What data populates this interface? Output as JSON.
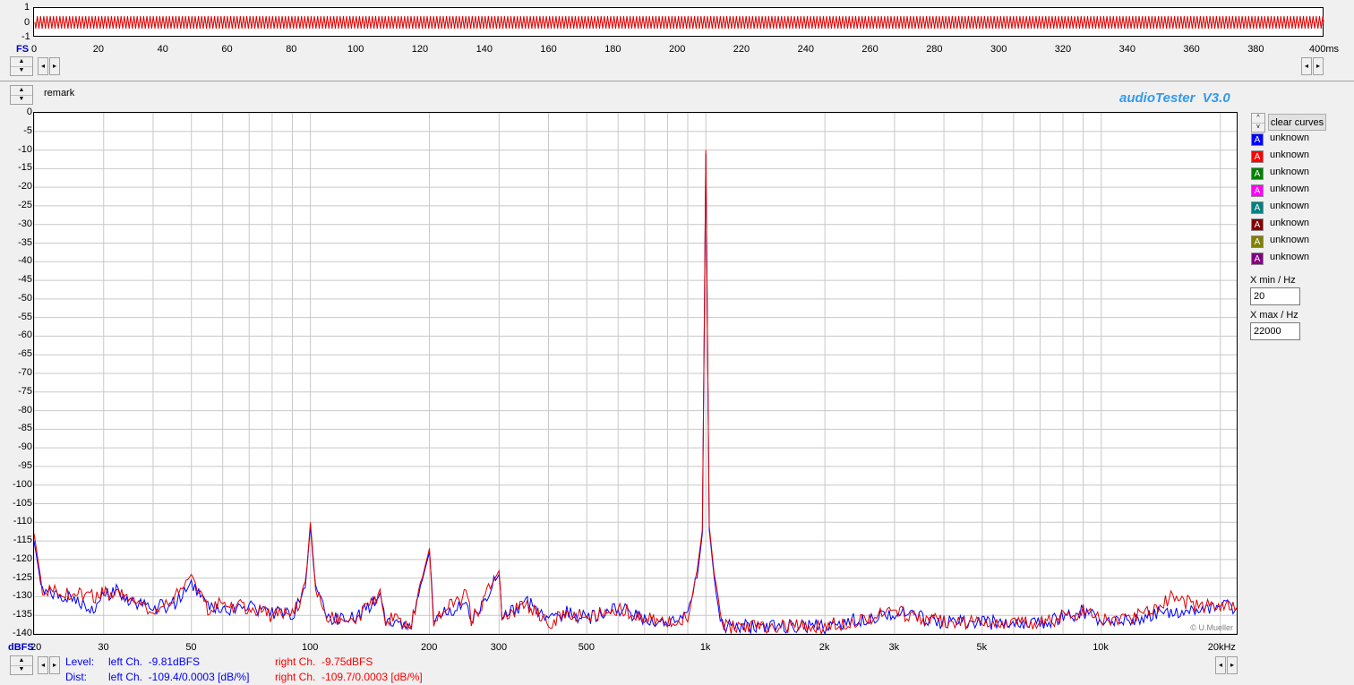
{
  "scope": {
    "y_ticks": [
      "1",
      "0",
      "-1"
    ],
    "x_unit_label": "FS",
    "x_ticks": [
      "0",
      "20",
      "40",
      "60",
      "80",
      "100",
      "120",
      "140",
      "160",
      "180",
      "200",
      "220",
      "240",
      "260",
      "280",
      "300",
      "320",
      "340",
      "360",
      "380",
      "400ms"
    ],
    "trace_color": "#e00000"
  },
  "remark_label": "remark",
  "brand": "audioTester  V3.0",
  "copyright": "© U.Mueller",
  "clear_curves_label": "clear curves",
  "legend": [
    {
      "label": "unknown",
      "letter": "A",
      "color": "#0000ff"
    },
    {
      "label": "unknown",
      "letter": "A",
      "color": "#ff0000"
    },
    {
      "label": "unknown",
      "letter": "A",
      "color": "#008000"
    },
    {
      "label": "unknown",
      "letter": "A",
      "color": "#ff00ff"
    },
    {
      "label": "unknown",
      "letter": "A",
      "color": "#008080"
    },
    {
      "label": "unknown",
      "letter": "A",
      "color": "#800000"
    },
    {
      "label": "unknown",
      "letter": "A",
      "color": "#808000"
    },
    {
      "label": "unknown",
      "letter": "A",
      "color": "#800080"
    }
  ],
  "xmin": {
    "label": "X min / Hz",
    "value": "20"
  },
  "xmax": {
    "label": "X max / Hz",
    "value": "22000"
  },
  "readout": {
    "level_label": "Level:",
    "dist_label": "Dist:",
    "left_level": "left Ch.  -9.81dBFS",
    "right_level": "right Ch.  -9.75dBFS",
    "left_dist": "left Ch.  -109.4/0.0003 [dB/%]",
    "right_dist": "right Ch.  -109.7/0.0003 [dB/%]",
    "left_color": "#0000ff",
    "right_color": "#ff0000"
  },
  "chart_data": {
    "type": "line",
    "title": "",
    "xlabel": "",
    "ylabel": "dBFS",
    "x_scale": "log",
    "xlim": [
      20,
      22000
    ],
    "ylim": [
      -140,
      0
    ],
    "y_ticks": [
      "0",
      "-5",
      "-10",
      "-15",
      "-20",
      "-25",
      "-30",
      "-35",
      "-40",
      "-45",
      "-50",
      "-55",
      "-60",
      "-65",
      "-70",
      "-75",
      "-80",
      "-85",
      "-90",
      "-95",
      "-100",
      "-105",
      "-110",
      "-115",
      "-120",
      "-125",
      "-130",
      "-135",
      "-140"
    ],
    "x_ticks": [
      {
        "v": 20,
        "label": "20"
      },
      {
        "v": 30,
        "label": "30"
      },
      {
        "v": 50,
        "label": "50"
      },
      {
        "v": 100,
        "label": "100"
      },
      {
        "v": 200,
        "label": "200"
      },
      {
        "v": 300,
        "label": "300"
      },
      {
        "v": 500,
        "label": "500"
      },
      {
        "v": 1000,
        "label": "1k"
      },
      {
        "v": 2000,
        "label": "2k"
      },
      {
        "v": 3000,
        "label": "3k"
      },
      {
        "v": 5000,
        "label": "5k"
      },
      {
        "v": 10000,
        "label": "10k"
      },
      {
        "v": 20000,
        "label": "20kHz"
      }
    ],
    "grid": true,
    "series": [
      {
        "color": "#0000ff",
        "points": [
          [
            20,
            -115
          ],
          [
            21,
            -129
          ],
          [
            25,
            -130
          ],
          [
            28,
            -133
          ],
          [
            30,
            -130
          ],
          [
            32,
            -128
          ],
          [
            35,
            -131
          ],
          [
            40,
            -133
          ],
          [
            45,
            -132
          ],
          [
            50,
            -127
          ],
          [
            55,
            -133
          ],
          [
            60,
            -134
          ],
          [
            70,
            -133
          ],
          [
            80,
            -134
          ],
          [
            90,
            -135
          ],
          [
            97,
            -128
          ],
          [
            100,
            -111
          ],
          [
            103,
            -128
          ],
          [
            110,
            -136
          ],
          [
            130,
            -136
          ],
          [
            150,
            -130
          ],
          [
            155,
            -136
          ],
          [
            180,
            -137
          ],
          [
            200,
            -118
          ],
          [
            205,
            -136
          ],
          [
            250,
            -131
          ],
          [
            255,
            -137
          ],
          [
            300,
            -124
          ],
          [
            305,
            -136
          ],
          [
            350,
            -131
          ],
          [
            400,
            -137
          ],
          [
            450,
            -134
          ],
          [
            500,
            -136
          ],
          [
            600,
            -133
          ],
          [
            700,
            -136
          ],
          [
            800,
            -137
          ],
          [
            900,
            -135
          ],
          [
            950,
            -125
          ],
          [
            980,
            -113
          ],
          [
            1000,
            -11
          ],
          [
            1020,
            -112
          ],
          [
            1050,
            -125
          ],
          [
            1100,
            -138
          ],
          [
            1500,
            -138
          ],
          [
            2000,
            -138
          ],
          [
            3000,
            -134
          ],
          [
            4000,
            -137
          ],
          [
            5000,
            -137
          ],
          [
            7000,
            -137
          ],
          [
            9000,
            -134
          ],
          [
            10000,
            -136
          ],
          [
            12000,
            -136
          ],
          [
            15000,
            -134
          ],
          [
            18000,
            -134
          ],
          [
            20000,
            -132
          ],
          [
            22000,
            -133
          ]
        ]
      },
      {
        "color": "#e00000",
        "points": [
          [
            20,
            -113
          ],
          [
            21,
            -128
          ],
          [
            25,
            -129
          ],
          [
            28,
            -130
          ],
          [
            30,
            -129
          ],
          [
            33,
            -129
          ],
          [
            35,
            -130
          ],
          [
            40,
            -134
          ],
          [
            45,
            -131
          ],
          [
            50,
            -124
          ],
          [
            55,
            -133
          ],
          [
            60,
            -132
          ],
          [
            70,
            -133
          ],
          [
            80,
            -135
          ],
          [
            90,
            -135
          ],
          [
            97,
            -128
          ],
          [
            100,
            -110
          ],
          [
            103,
            -127
          ],
          [
            110,
            -136
          ],
          [
            130,
            -136
          ],
          [
            150,
            -129
          ],
          [
            155,
            -136
          ],
          [
            180,
            -137
          ],
          [
            200,
            -117
          ],
          [
            205,
            -136
          ],
          [
            250,
            -129
          ],
          [
            255,
            -137
          ],
          [
            300,
            -123
          ],
          [
            305,
            -136
          ],
          [
            350,
            -132
          ],
          [
            400,
            -137
          ],
          [
            450,
            -134
          ],
          [
            500,
            -136
          ],
          [
            600,
            -133
          ],
          [
            700,
            -136
          ],
          [
            800,
            -137
          ],
          [
            900,
            -135
          ],
          [
            950,
            -123
          ],
          [
            980,
            -112
          ],
          [
            1000,
            -10
          ],
          [
            1020,
            -111
          ],
          [
            1050,
            -124
          ],
          [
            1100,
            -138
          ],
          [
            1500,
            -138
          ],
          [
            2000,
            -138
          ],
          [
            3000,
            -134
          ],
          [
            4000,
            -137
          ],
          [
            5000,
            -137
          ],
          [
            7000,
            -137
          ],
          [
            9000,
            -134
          ],
          [
            10000,
            -136
          ],
          [
            12000,
            -136
          ],
          [
            15000,
            -130
          ],
          [
            18000,
            -133
          ],
          [
            20000,
            -132
          ],
          [
            22000,
            -133
          ]
        ]
      }
    ]
  }
}
